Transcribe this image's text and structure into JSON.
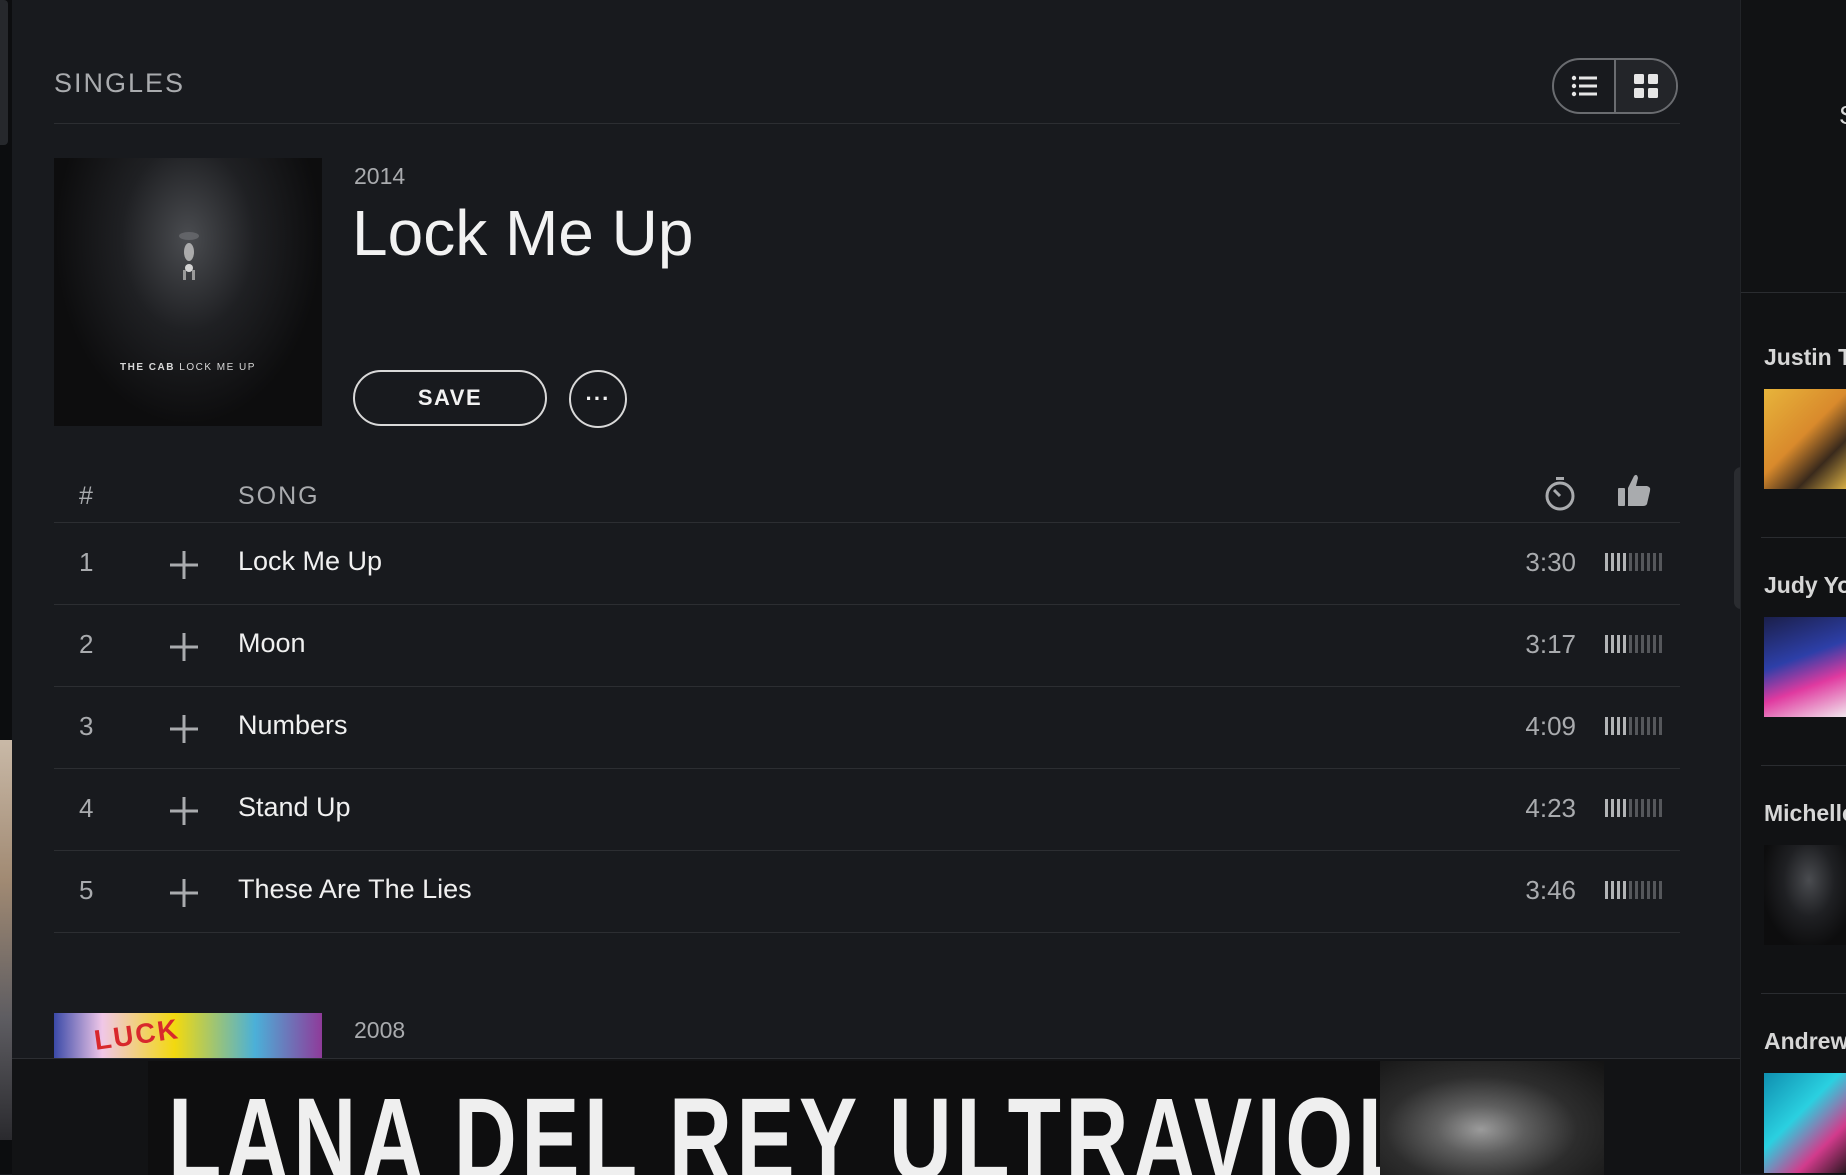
{
  "section": {
    "title": "SINGLES"
  },
  "album": {
    "year": "2014",
    "title": "Lock Me Up",
    "art_caption_artist": "THE CAB",
    "art_caption_title": "LOCK ME UP",
    "save_label": "SAVE",
    "more_label": "···"
  },
  "track_header": {
    "number": "#",
    "song": "SONG"
  },
  "tracks": [
    {
      "number": "1",
      "title": "Lock Me Up",
      "duration": "3:30",
      "popularity_bars": 4
    },
    {
      "number": "2",
      "title": "Moon",
      "duration": "3:17",
      "popularity_bars": 4
    },
    {
      "number": "3",
      "title": "Numbers",
      "duration": "4:09",
      "popularity_bars": 4
    },
    {
      "number": "4",
      "title": "Stand Up",
      "duration": "4:23",
      "popularity_bars": 4
    },
    {
      "number": "5",
      "title": "These Are The Lies",
      "duration": "3:46",
      "popularity_bars": 4
    }
  ],
  "next_album": {
    "year": "2008",
    "art_text": "LUCK"
  },
  "banner": {
    "text": "LANA DEL REY  ULTRAVIOLENCE"
  },
  "right_panel": {
    "top_letter": "S",
    "friends": [
      {
        "name": "Justin T"
      },
      {
        "name": "Judy Yo"
      },
      {
        "name": "Michelle"
      },
      {
        "name": "Andrew"
      }
    ]
  },
  "colors": {
    "background": "#181a1e",
    "text": "#f0f0f0",
    "muted": "#a9abae",
    "divider": "#2c2e32"
  }
}
